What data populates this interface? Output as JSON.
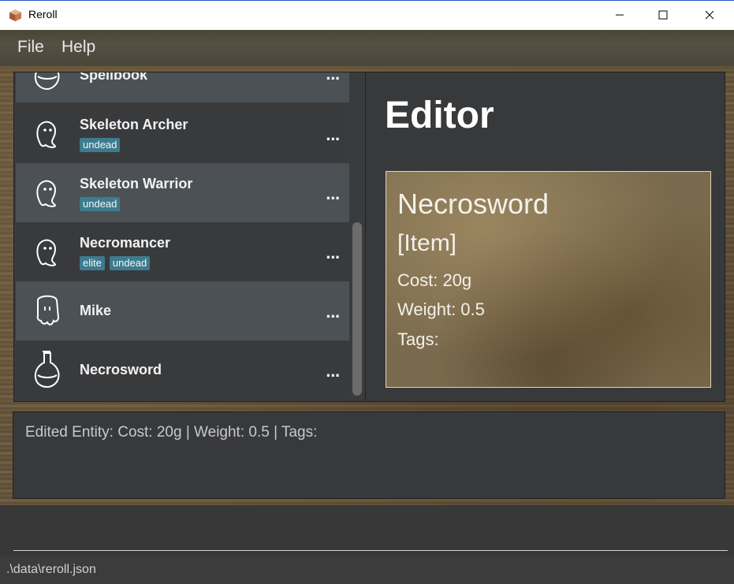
{
  "window": {
    "title": "Reroll"
  },
  "menu": {
    "file": "File",
    "help": "Help"
  },
  "entities": [
    {
      "name": "Spellbook",
      "tags": [],
      "icon": "potion-icon"
    },
    {
      "name": "Skeleton Archer",
      "tags": [
        "undead"
      ],
      "icon": "ghost-icon"
    },
    {
      "name": "Skeleton Warrior",
      "tags": [
        "undead"
      ],
      "icon": "ghost-icon"
    },
    {
      "name": "Necromancer",
      "tags": [
        "elite",
        "undead"
      ],
      "icon": "ghost-icon"
    },
    {
      "name": "Mike",
      "tags": [],
      "icon": "ghost-square-icon"
    },
    {
      "name": "Necrosword",
      "tags": [],
      "icon": "potion-icon"
    }
  ],
  "card_menu_label": "...",
  "editor": {
    "title": "Editor",
    "name": "Necrosword",
    "type": "[Item]",
    "cost": "Cost: 20g",
    "weight": "Weight: 0.5",
    "tags": "Tags:"
  },
  "result": {
    "text": "Edited Entity: Cost: 20g | Weight: 0.5 | Tags:"
  },
  "command": {
    "value": ""
  },
  "status": {
    "path": ".\\data\\reroll.json"
  }
}
